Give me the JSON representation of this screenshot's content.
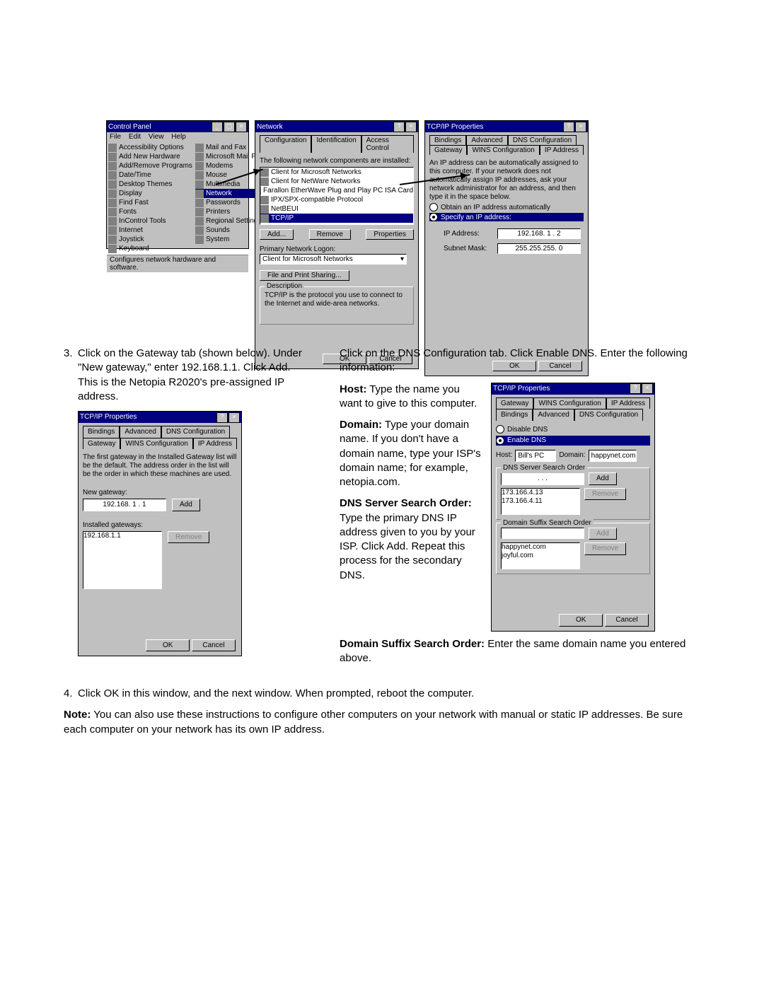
{
  "control_panel": {
    "title": "Control Panel",
    "menu": [
      "File",
      "Edit",
      "View",
      "Help"
    ],
    "items_left": [
      "Accessibility Options",
      "Add New Hardware",
      "Add/Remove Programs",
      "Date/Time",
      "Desktop Themes",
      "Display",
      "Find Fast",
      "Fonts",
      "InControl Tools",
      "Internet",
      "Joystick",
      "Keyboard"
    ],
    "items_right": [
      "Mail and Fax",
      "Microsoft Mail Postoffice",
      "Modems",
      "Mouse",
      "Multimedia",
      "Network",
      "Passwords",
      "Printers",
      "Regional Settings",
      "Sounds",
      "System"
    ],
    "highlight": "Network",
    "status": "Configures network hardware and software."
  },
  "network": {
    "title": "Network",
    "tabs": [
      "Configuration",
      "Identification",
      "Access Control"
    ],
    "list_label": "The following network components are installed:",
    "components": [
      "Client for Microsoft Networks",
      "Client for NetWare Networks",
      "Farallon EtherWave Plug and Play PC ISA Card",
      "IPX/SPX-compatible Protocol",
      "NetBEUI",
      "TCP/IP"
    ],
    "selected": "TCP/IP",
    "btn_add": "Add...",
    "btn_remove": "Remove",
    "btn_props": "Properties",
    "logon_label": "Primary Network Logon:",
    "logon_value": "Client for Microsoft Networks",
    "btn_share": "File and Print Sharing...",
    "desc_label": "Description",
    "desc_value": "TCP/IP is the protocol you use to connect to the Internet and wide-area networks.",
    "btn_ok": "OK",
    "btn_cancel": "Cancel"
  },
  "ip1": {
    "title": "TCP/IP Properties",
    "tabs_top": [
      "Bindings",
      "Advanced",
      "DNS Configuration"
    ],
    "tabs_bot": [
      "Gateway",
      "WINS Configuration",
      "IP Address"
    ],
    "info": "An IP address can be automatically assigned to this computer. If your network does not automatically assign IP addresses, ask your network administrator for an address, and then type it in the space below.",
    "radio1": "Obtain an IP address automatically",
    "radio2": "Specify an IP address:",
    "ip_label": "IP Address:",
    "ip_value": "192.168. 1 . 2",
    "mask_label": "Subnet Mask:",
    "mask_value": "255.255.255. 0",
    "btn_ok": "OK",
    "btn_cancel": "Cancel"
  },
  "gw": {
    "title": "TCP/IP Properties",
    "tabs_top": [
      "Bindings",
      "Advanced",
      "DNS Configuration"
    ],
    "tabs_bot": [
      "Gateway",
      "WINS Configuration",
      "IP Address"
    ],
    "info": "The first gateway in the Installed Gateway list will be the default. The address order in the list will be the order in which these machines are used.",
    "new_label": "New gateway:",
    "new_value": "192.168. 1 . 1",
    "btn_add": "Add",
    "installed_label": "Installed gateways:",
    "installed_value": "192.168.1.1",
    "btn_remove": "Remove",
    "btn_ok": "OK",
    "btn_cancel": "Cancel"
  },
  "dns": {
    "title": "TCP/IP Properties",
    "tabs_top": [
      "Gateway",
      "WINS Configuration",
      "IP Address"
    ],
    "tabs_bot": [
      "Bindings",
      "Advanced",
      "DNS Configuration"
    ],
    "radio1": "Disable DNS",
    "radio2": "Enable DNS",
    "host_label": "Host:",
    "host_value": "Bill's PC",
    "domain_label": "Domain:",
    "domain_value": "happynet.com",
    "search_label": "DNS Server Search Order",
    "search_input": " .  .  . ",
    "btn_add": "Add",
    "btn_remove": "Remove",
    "servers": [
      "173.166.4.13",
      "173.166.4.11"
    ],
    "suffix_label": "Domain Suffix Search Order",
    "btn_add2": "Add",
    "btn_remove2": "Remove",
    "suffixes": [
      "happynet.com",
      "joyful.com"
    ],
    "btn_ok": "OK",
    "btn_cancel": "Cancel"
  },
  "text": {
    "step3a_num": "3.",
    "step3a": "Click on the Gateway tab (shown below). Under \"New gateway,\" enter 192.168.1.1. Click Add. This is the Netopia R2020's pre-assigned IP address.",
    "step3b": "Click on the DNS Configuration tab. Click Enable DNS. Enter the following information:",
    "host_h": "Host:",
    "host_t": " Type the name you want to give to this computer.",
    "dom_h": "Domain:",
    "dom_t": " Type your domain name. If you don't have a domain name, type your ISP's domain name; for example, netopia.com.",
    "dns_h": "DNS Server Search Order:",
    "dns_t": " Type the primary DNS IP address given to you by your ISP. Click Add. Repeat this process for the secondary DNS.",
    "suf_h": "Domain Suffix Search Order:",
    "suf_t": " Enter the same domain name you entered above.",
    "step4_num": "4.",
    "step4": "Click OK in this window, and the next window. When prompted, reboot the computer.",
    "note_h": "Note:",
    "note_t": " You can also use these instructions to configure other computers on your network with manual or static IP addresses. Be sure each computer on your network has its own IP address."
  }
}
